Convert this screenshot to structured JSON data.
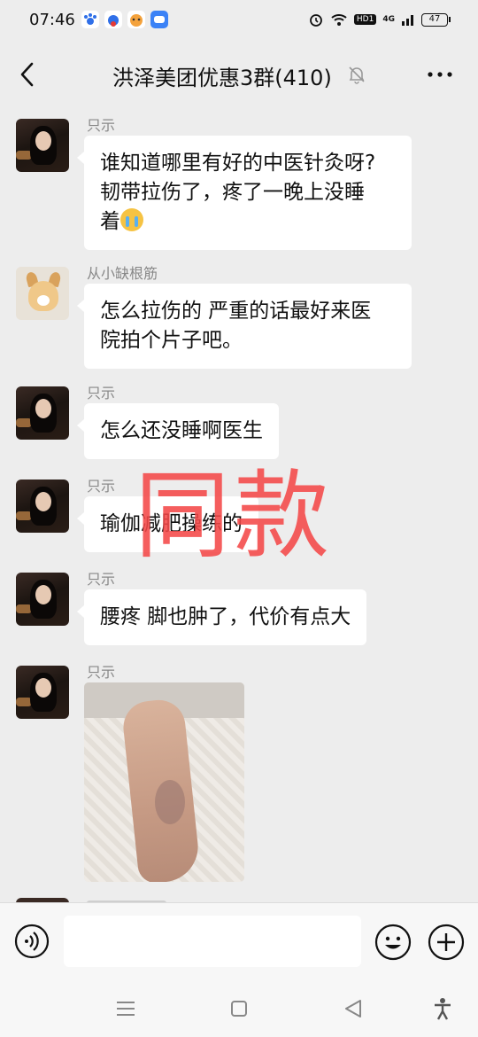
{
  "status_bar": {
    "time": "07:46",
    "network": "4G",
    "hd_label": "HD1",
    "battery": "47"
  },
  "header": {
    "title": "洪泽美团优惠3群(410)"
  },
  "messages": [
    {
      "sender": "只示",
      "text_lines": [
        "谁知道哪里有好的中医针灸呀?",
        "韧带拉伤了，疼了一晚上没睡",
        "着"
      ]
    },
    {
      "sender": "从小缺根筋",
      "text_lines": [
        "怎么拉伤的 严重的话最好来医",
        "院拍个片子吧。"
      ]
    },
    {
      "sender": "只示",
      "text_lines": [
        "怎么还没睡啊医生"
      ]
    },
    {
      "sender": "只示",
      "text_lines": [
        "瑜伽减肥操练的"
      ]
    },
    {
      "sender": "只示",
      "text_lines": [
        "腰疼  脚也肿了，代价有点大"
      ]
    },
    {
      "sender": "只示",
      "image": "foot-photo"
    }
  ],
  "overlay": {
    "watermark": "同款"
  },
  "colors": {
    "background": "#ededed",
    "bubble": "#ffffff",
    "watermark": "#f44848"
  },
  "icons": {
    "back": "chevron-left-icon",
    "mute": "bell-off-icon",
    "more": "more-dots-icon",
    "voice": "voice-icon",
    "emoji": "emoji-icon",
    "plus": "plus-icon"
  }
}
